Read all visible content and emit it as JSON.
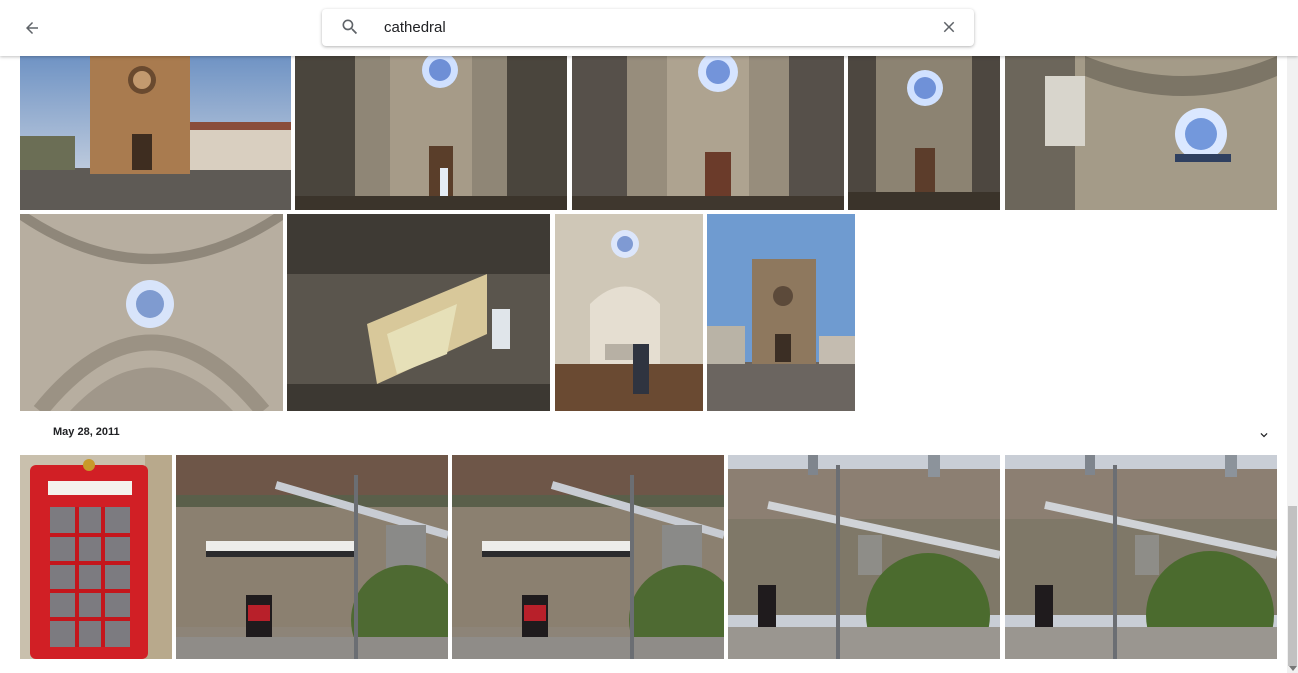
{
  "search": {
    "query": "cathedral"
  },
  "section": {
    "date_label": "May 28, 2011"
  },
  "icons": {
    "back": "arrow-left-icon",
    "search": "search-icon",
    "clear": "close-icon",
    "expand": "chevron-down-icon"
  },
  "colors": {
    "text": "#202124",
    "icon": "#5f6368"
  }
}
